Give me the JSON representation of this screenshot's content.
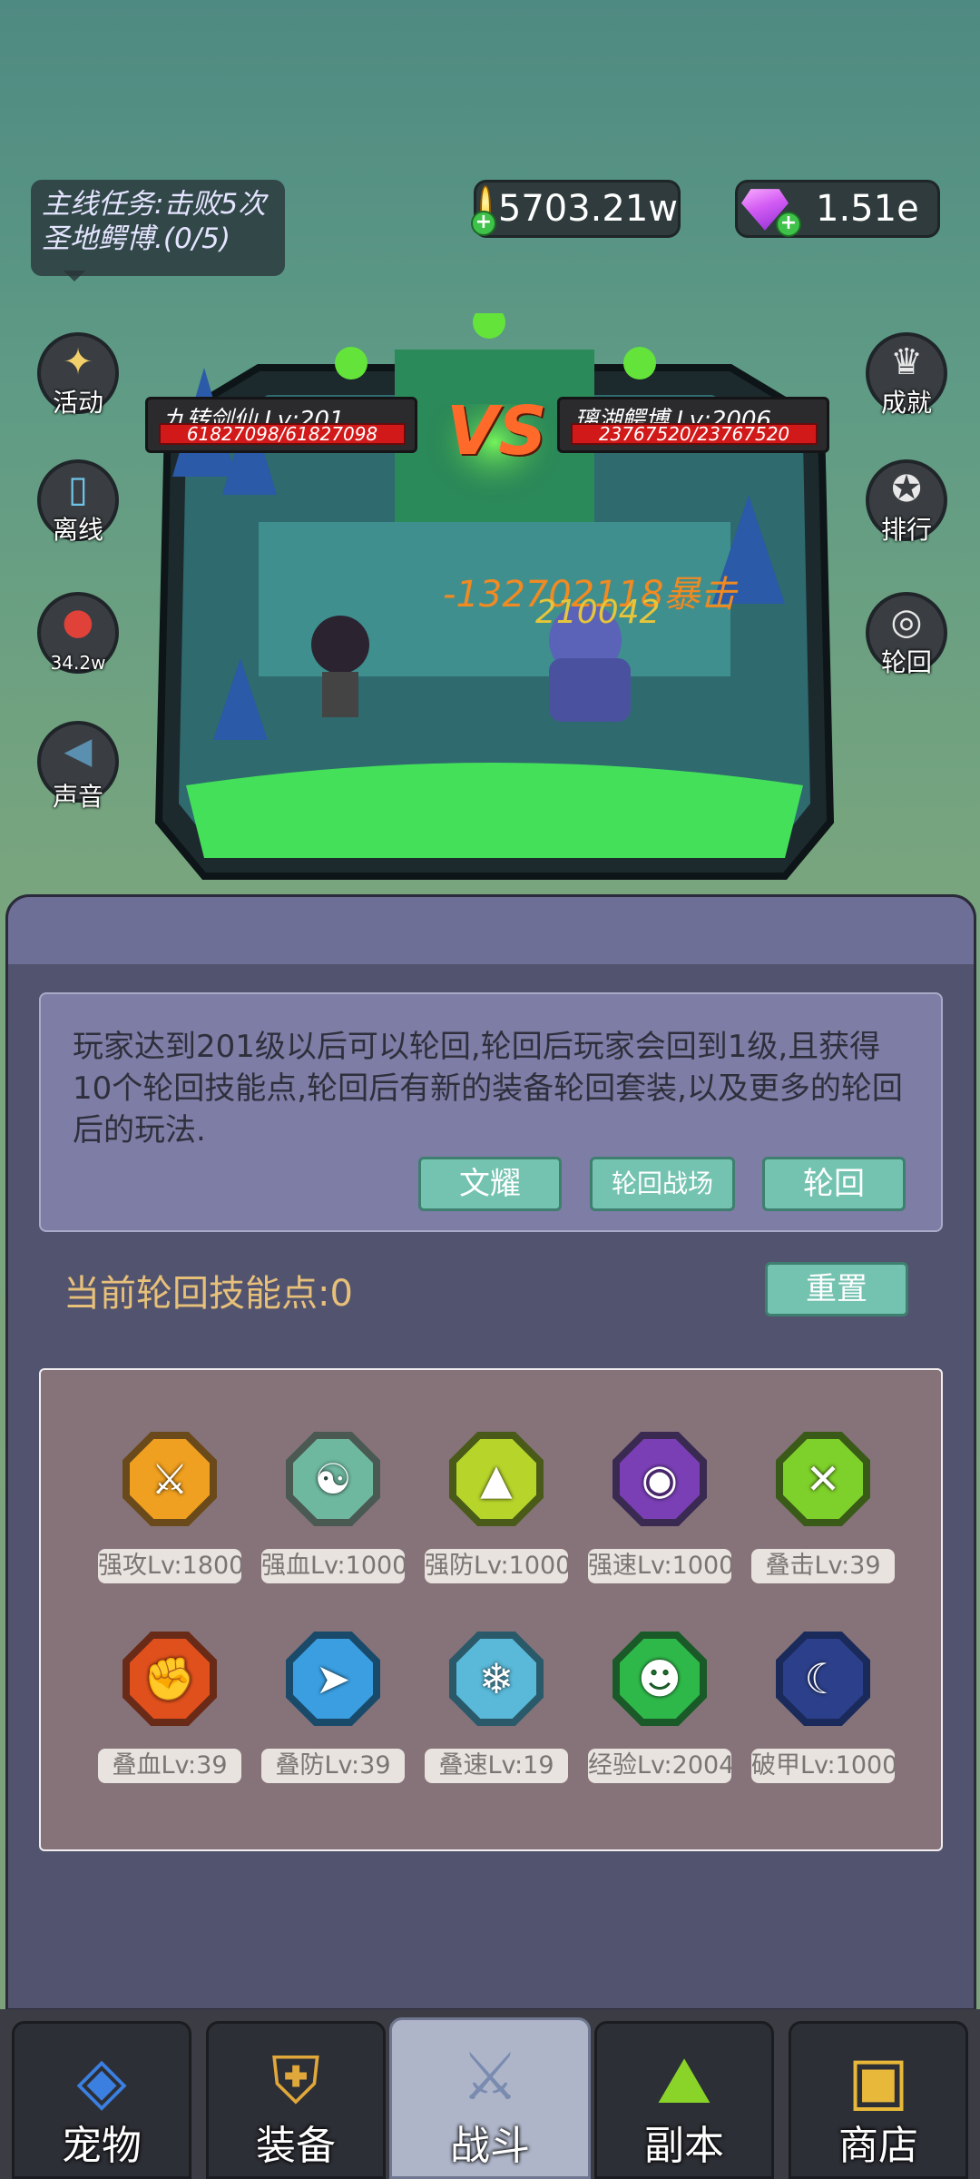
{
  "hud": {
    "quest": "主线任务:击败5次圣地鳄博.(0/5)",
    "gold": "5703.21w",
    "gems": "1.51e"
  },
  "left_buttons": [
    {
      "label": "活动",
      "icon": "stars-icon"
    },
    {
      "label": "离线",
      "icon": "offline-phone-icon"
    },
    {
      "label": "34.2w",
      "icon": "potion-icon"
    },
    {
      "label": "声音",
      "icon": "speaker-icon"
    }
  ],
  "right_buttons": [
    {
      "label": "成就",
      "icon": "trophy-icon"
    },
    {
      "label": "排行",
      "icon": "medal-icon"
    },
    {
      "label": "轮回",
      "icon": "swirl-icon"
    }
  ],
  "battle": {
    "player_name": "九转剑仙 Lv:201",
    "player_hp": "61827098/61827098",
    "player_hp_fraction": 1.0,
    "enemy_name": "璃湖鳄博 Lv:2006",
    "enemy_hp": "23767520/23767520",
    "enemy_hp_fraction": 1.0,
    "vs": "VS",
    "damage_text": "-132702118",
    "crit_text": "暴击",
    "damage_text_2": "210042"
  },
  "reincarnation": {
    "description": "玩家达到201级以后可以轮回,轮回后玩家会回到1级,且获得10个轮回技能点,轮回后有新的装备轮回套装,以及更多的轮回后的玩法.",
    "btn_wenyao": "文耀",
    "btn_arena": "轮回战场",
    "btn_reincarnate": "轮回",
    "skill_points": "当前轮回技能点:0",
    "btn_reset": "重置"
  },
  "skills": [
    {
      "label": "强攻Lv:1800",
      "icon": "sword-icon",
      "color": "#f0a020"
    },
    {
      "label": "强血Lv:1000",
      "icon": "meditate-icon",
      "color": "#6fb8a0"
    },
    {
      "label": "强防Lv:1000",
      "icon": "boot-icon",
      "color": "#b6d42a"
    },
    {
      "label": "强速Lv:1000",
      "icon": "eye-shield-icon",
      "color": "#7a3fb5"
    },
    {
      "label": "叠击Lv:39",
      "icon": "slash-icon",
      "color": "#7ed02a"
    },
    {
      "label": "叠血Lv:39",
      "icon": "flex-icon",
      "color": "#e0501c"
    },
    {
      "label": "叠防Lv:39",
      "icon": "dash-icon",
      "color": "#3a9ee0"
    },
    {
      "label": "叠速Lv:19",
      "icon": "snowflake-shield-icon",
      "color": "#5ab8d8"
    },
    {
      "label": "经验Lv:2004",
      "icon": "figure-icon",
      "color": "#2fb84a"
    },
    {
      "label": "破甲Lv:1000",
      "icon": "moon-strike-icon",
      "color": "#2c3f8a"
    }
  ],
  "nav": [
    {
      "label": "宠物",
      "icon": "pet-egg-icon"
    },
    {
      "label": "装备",
      "icon": "helmet-icon"
    },
    {
      "label": "战斗",
      "icon": "crossed-swords-icon"
    },
    {
      "label": "副本",
      "icon": "dungeon-icon"
    },
    {
      "label": "商店",
      "icon": "treasure-chest-icon"
    }
  ]
}
